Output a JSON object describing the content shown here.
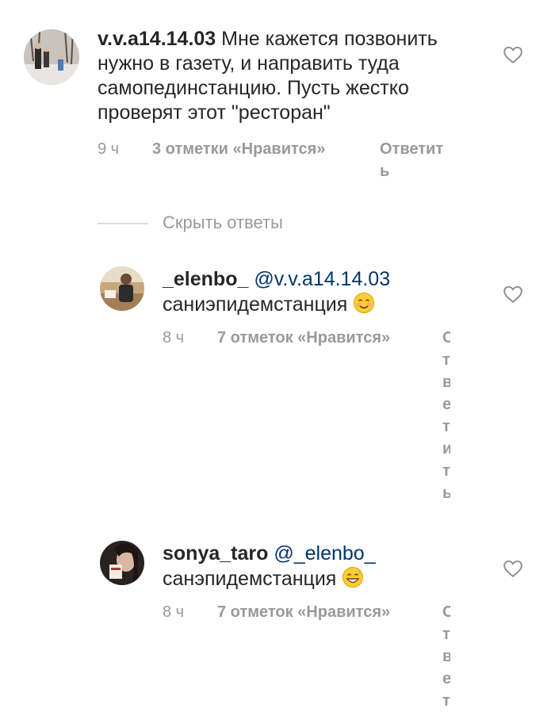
{
  "comments": [
    {
      "username": "v.v.a14.14.03",
      "text": "Мне кажется позвонить нужно в газету, и направить туда самопединстанцию. Пусть жестко проверят этот \"ресторан\"",
      "time": "9 ч",
      "likes": "3 отметки «Нравится»",
      "reply": "Ответить"
    },
    {
      "username": "_elenbo_",
      "mention": "@v.v.a14.14.03",
      "text": "саниэпидемстанция",
      "time": "8 ч",
      "likes": "7 отметок «Нравится»",
      "reply": "Ответить"
    },
    {
      "username": "sonya_taro",
      "mention": "@_elenbo_",
      "text": "санэпидемстанция",
      "time": "8 ч",
      "likes": "7 отметок «Нравится»",
      "reply": "Ответ"
    }
  ],
  "hide_replies": "Скрыть ответы",
  "icons": {
    "like": "heart-outline-icon",
    "emoji_1": "smiling-face-icon",
    "emoji_2": "grinning-sweat-face-icon"
  }
}
